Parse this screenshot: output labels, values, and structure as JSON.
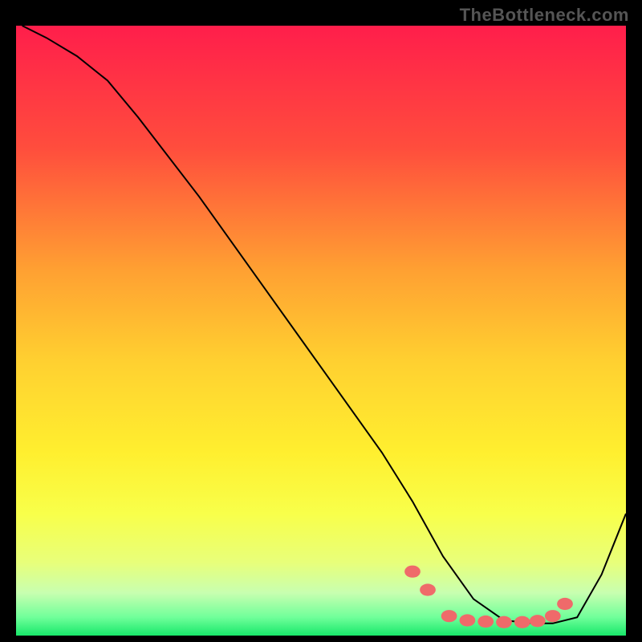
{
  "watermark": "TheBottleneck.com",
  "chart_data": {
    "type": "line",
    "title": "",
    "xlabel": "",
    "ylabel": "",
    "xlim": [
      0,
      100
    ],
    "ylim": [
      0,
      100
    ],
    "gradient_stops": [
      {
        "offset": 0,
        "color": "#ff1e4b"
      },
      {
        "offset": 20,
        "color": "#ff4d3d"
      },
      {
        "offset": 40,
        "color": "#ffa032"
      },
      {
        "offset": 55,
        "color": "#ffd030"
      },
      {
        "offset": 70,
        "color": "#ffef2f"
      },
      {
        "offset": 80,
        "color": "#f8ff4a"
      },
      {
        "offset": 88,
        "color": "#e8ff7a"
      },
      {
        "offset": 93,
        "color": "#c8ffb0"
      },
      {
        "offset": 97,
        "color": "#70ff9a"
      },
      {
        "offset": 100,
        "color": "#18e86a"
      }
    ],
    "series": [
      {
        "name": "bottleneck-curve",
        "x": [
          1,
          5,
          10,
          15,
          20,
          30,
          40,
          50,
          60,
          65,
          70,
          75,
          80,
          85,
          88,
          92,
          96,
          100
        ],
        "y": [
          100,
          98,
          95,
          91,
          85,
          72,
          58,
          44,
          30,
          22,
          13,
          6,
          2.5,
          2,
          2,
          3,
          10,
          20
        ]
      }
    ],
    "markers": {
      "name": "highlight-points",
      "color": "#ef6a6a",
      "x": [
        65,
        67.5,
        71,
        74,
        77,
        80,
        83,
        85.5,
        88,
        90
      ],
      "y": [
        10.5,
        7.5,
        3.2,
        2.5,
        2.3,
        2.2,
        2.2,
        2.4,
        3.2,
        5.2
      ]
    }
  }
}
